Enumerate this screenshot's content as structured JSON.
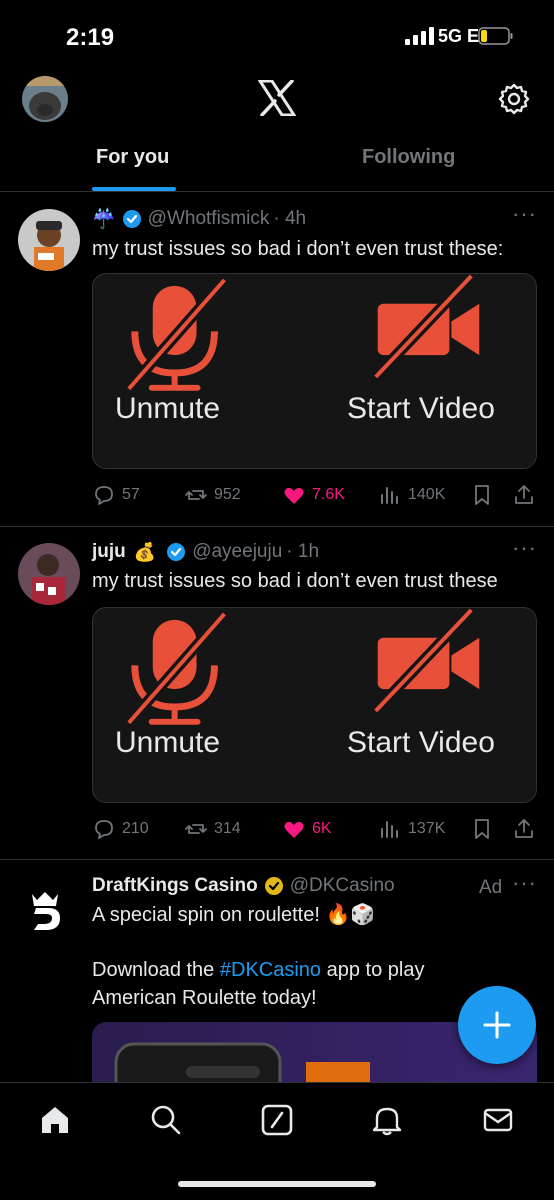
{
  "status_bar": {
    "time": "2:19",
    "network": "5G E"
  },
  "header": {
    "logo_icon": "x-logo-icon",
    "settings_icon": "gear-icon",
    "tabs": [
      {
        "label": "For you",
        "active": true
      },
      {
        "label": "Following",
        "active": false
      }
    ]
  },
  "tweets": [
    {
      "name_emoji": "☔",
      "handle": "@Whotfismick",
      "time": "· 4h",
      "verified": true,
      "text": "my trust issues so bad i don’t even trust these:",
      "media": {
        "left_label": "Unmute",
        "right_label": "Start Video"
      },
      "stats": {
        "replies": "57",
        "reposts": "952",
        "likes": "7.6K",
        "views": "140K",
        "liked": true
      }
    },
    {
      "name": "juju",
      "name_emoji": "💰",
      "handle": "@ayeejuju",
      "time": "· 1h",
      "verified": true,
      "text": "my trust issues so bad i don’t even trust these",
      "media": {
        "left_label": "Unmute",
        "right_label": "Start Video"
      },
      "stats": {
        "replies": "210",
        "reposts": "314",
        "likes": "6K",
        "views": "137K",
        "liked": true
      }
    }
  ],
  "ad": {
    "name": "DraftKings Casino",
    "handle": "@DKCasino",
    "ad_label": "Ad",
    "text_line1": "A special spin on roulette! 🔥🎲",
    "text_line2_pre": "Download the ",
    "text_line2_hashtag": "#DKCasino",
    "text_line2_post": " app to play",
    "text_line3": "American Roulette today!"
  },
  "fab": {
    "icon": "plus-icon"
  },
  "bottom_nav": [
    {
      "icon": "home-icon",
      "active": true
    },
    {
      "icon": "search-icon"
    },
    {
      "icon": "grok-icon"
    },
    {
      "icon": "bell-icon"
    },
    {
      "icon": "mail-icon"
    }
  ],
  "colors": {
    "accent": "#1d9bf0",
    "like": "#f91880",
    "muted": "#71767b",
    "mic_red": "#e8503a"
  }
}
